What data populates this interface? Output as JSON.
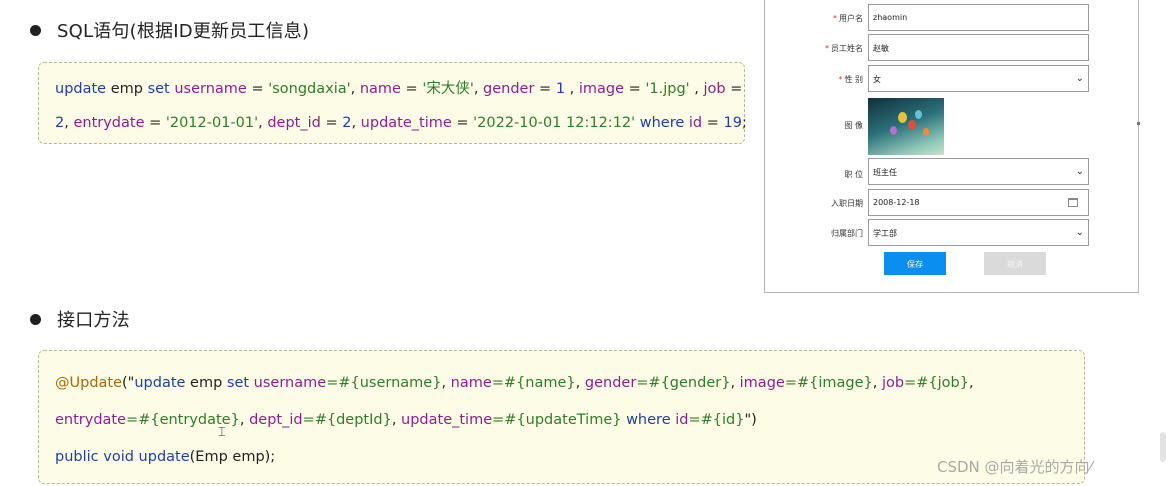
{
  "sections": {
    "sql_title": "SQL语句(根据ID更新员工信息)",
    "api_title": "接口方法"
  },
  "sql": {
    "l1_update": "update",
    "l1_emp": " emp ",
    "l1_set": "set",
    "l1_username": " username",
    "l1_eq1": " = ",
    "l1_v_username": "'songdaxia'",
    "l1_c1": ", ",
    "l1_name": "name",
    "l1_eq2": " = ",
    "l1_v_name": "'宋大侠'",
    "l1_c2": ", ",
    "l1_gender": "gender",
    "l1_eq3": " = ",
    "l1_v_gender": "1",
    "l1_c3": " , ",
    "l1_image": "image",
    "l1_eq4": " = ",
    "l1_v_image": "'1.jpg'",
    "l1_c4": " , ",
    "l1_job": "job",
    "l1_eq5": " =",
    "l2_v_job": "2",
    "l2_c1": ", ",
    "l2_entrydate": "entrydate",
    "l2_eq1": " = ",
    "l2_v_entrydate": "'2012-01-01'",
    "l2_c2": ", ",
    "l2_dept_id": "dept_id",
    "l2_eq2": " = ",
    "l2_v_dept": "2",
    "l2_c3": ", ",
    "l2_update_time": "update_time",
    "l2_eq3": " = ",
    "l2_v_time": "'2022-10-01 12:12:12'",
    "l2_where": " where ",
    "l2_id": "id",
    "l2_eq4": " = ",
    "l2_v_id": "19",
    "l2_end": ";"
  },
  "api": {
    "l1_annot": "@Update",
    "l1_paren": "(\"",
    "l1_update": "update",
    "l1_emp": " emp ",
    "l1_set": "set",
    "l1_username": " username",
    "l1_p_username": "=#{username}",
    "l1_c1": ", ",
    "l1_name": "name",
    "l1_p_name": "=#{name}",
    "l1_c2": ", ",
    "l1_gender": "gender",
    "l1_p_gender": "=#{gender}",
    "l1_c3": ", ",
    "l1_image": "image",
    "l1_p_image": "=#{image}",
    "l1_c4": ", ",
    "l1_job": "job",
    "l1_p_job": "=#{job}",
    "l1_c5": ",",
    "l2_entrydate": "entrydate",
    "l2_p_entrydate": "=#{entrydate}",
    "l2_c1": ", ",
    "l2_dept_id": "dept_id",
    "l2_p_dept": "=#{deptId}",
    "l2_c2": ", ",
    "l2_update_time": "update_time",
    "l2_p_time": "=#{updateTime}",
    "l2_where": " where ",
    "l2_id": "id",
    "l2_p_id": "=#{id}",
    "l2_end": "\")",
    "l3_public": "public",
    "l3_void": " void ",
    "l3_method": "update",
    "l3_sig": "(Emp emp);"
  },
  "form": {
    "username_label": "用户名",
    "username_value": "zhaomin",
    "name_label": "员工姓名",
    "name_value": "赵敏",
    "gender_label": "性    别",
    "gender_value": "女",
    "image_label": "图    像",
    "job_label": "职    位",
    "job_value": "班主任",
    "entrydate_label": "入职日期",
    "entrydate_value": "2008-12-18",
    "dept_label": "归属部门",
    "dept_value": "学工部",
    "required_mark": "*",
    "save_label": "保存",
    "cancel_label": "取消",
    "chevron": "⌄"
  },
  "watermark": "CSDN @向着光的方向⁄",
  "colors": {
    "keyword": "#1e3fa3",
    "field": "#8b1f8f",
    "string": "#2f7d27",
    "annotation": "#a36b00",
    "save_button": "#0a8ef0",
    "code_background": "#fdfde7"
  }
}
